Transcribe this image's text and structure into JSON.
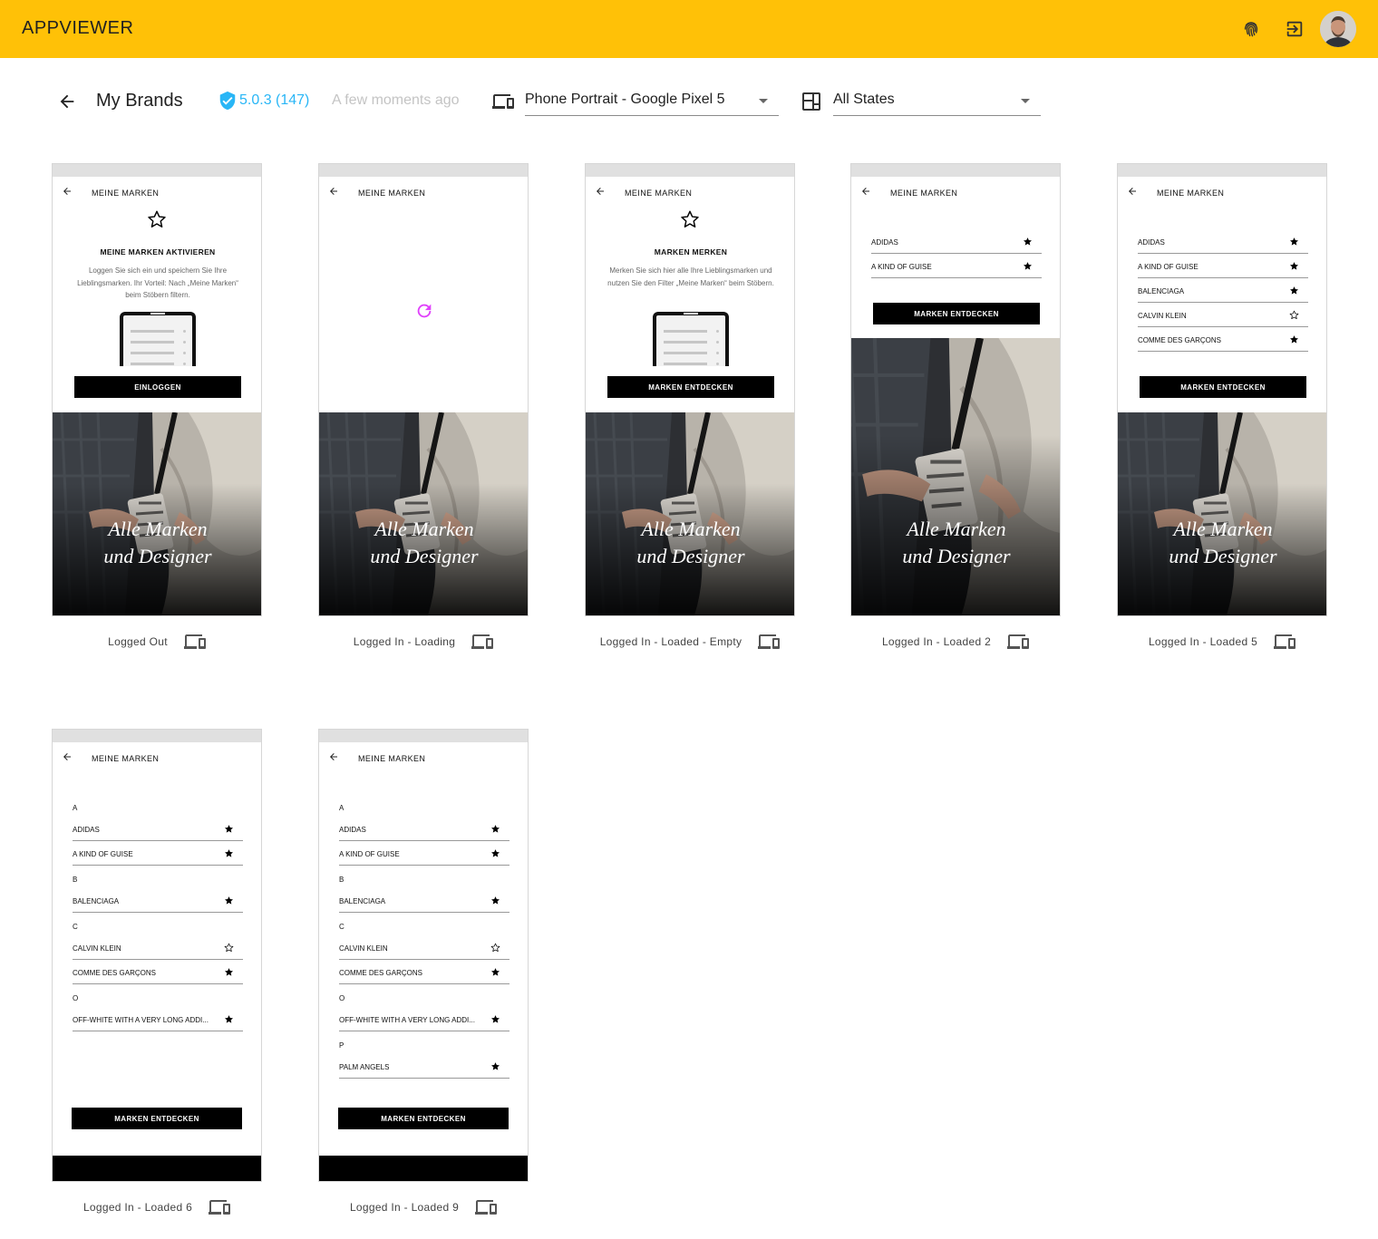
{
  "app": {
    "title": "APPVIEWER"
  },
  "header": {
    "page_title": "My Brands",
    "version": "5.0.3 (147)",
    "timestamp": "A few moments ago",
    "device_select": "Phone Portrait - Google Pixel 5",
    "state_select": "All States"
  },
  "colors": {
    "appbar": "#FFC107",
    "version": "#29B6F6",
    "spinner": "#E040FB"
  },
  "phone": {
    "title": "MEINE MARKEN",
    "hero_line1": "Alle Marken",
    "hero_line2": "und Designer",
    "logged_out_heading": "MEINE MARKEN AKTIVIEREN",
    "logged_out_text": "Loggen Sie sich ein und speichern Sie Ihre Lieblingsmarken. Ihr Vorteil: Nach „Meine Marken“ beim Stöbern filtern.",
    "login_button": "EINLOGGEN",
    "empty_heading": "MARKEN MERKEN",
    "empty_text": "Merken Sie sich hier alle Ihre Lieblingsmarken und nutzen Sie den Filter „Meine Marken“ beim Stöbern.",
    "discover_button": "MARKEN ENTDECKEN"
  },
  "brands": {
    "adidas": "ADIDAS",
    "kind": "A KIND OF GUISE",
    "balenciaga": "BALENCIAGA",
    "calvin": "CALVIN KLEIN",
    "comme": "COMME DES GARÇONS",
    "offwhite": "OFF-WHITE WITH A VERY LONG ADDI...",
    "palm": "PALM ANGELS"
  },
  "letters": {
    "a": "A",
    "b": "B",
    "c": "C",
    "o": "O",
    "p": "P"
  },
  "states": [
    {
      "label": "Logged Out"
    },
    {
      "label": "Logged In - Loading"
    },
    {
      "label": "Logged In - Loaded - Empty"
    },
    {
      "label": "Logged In - Loaded 2"
    },
    {
      "label": "Logged In - Loaded 5"
    },
    {
      "label": "Logged In - Loaded 6"
    },
    {
      "label": "Logged In - Loaded 9"
    }
  ]
}
